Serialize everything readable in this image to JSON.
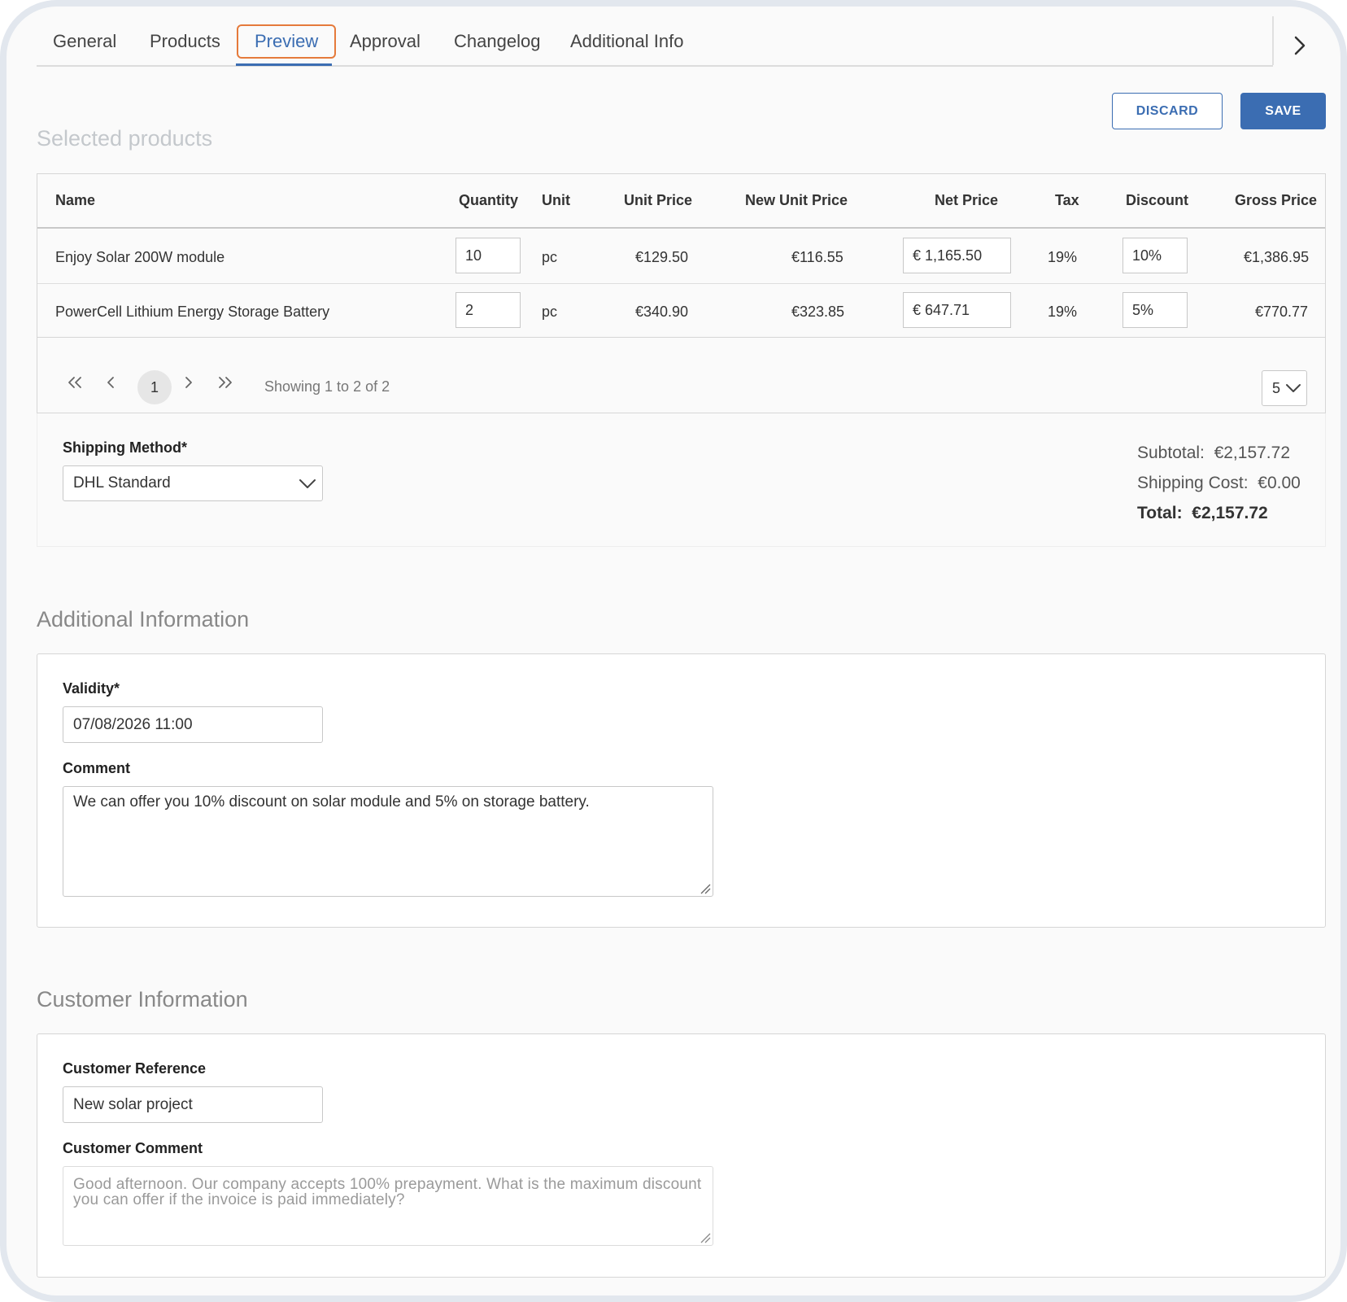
{
  "tabs": [
    {
      "label": "General"
    },
    {
      "label": "Products"
    },
    {
      "label": "Preview"
    },
    {
      "label": "Approval"
    },
    {
      "label": "Changelog"
    },
    {
      "label": "Additional Info"
    }
  ],
  "active_tab": "Preview",
  "actions": {
    "discard_label": "DISCARD",
    "save_label": "SAVE"
  },
  "selected_products": {
    "title": "Selected products",
    "columns": [
      "Name",
      "Quantity",
      "Unit",
      "Unit Price",
      "New Unit Price",
      "Net Price",
      "Tax",
      "Discount",
      "Gross Price"
    ],
    "rows": [
      {
        "name": "Enjoy Solar 200W module",
        "quantity": "10",
        "unit": "pc",
        "unit_price": "€129.50",
        "new_unit_price": "€116.55",
        "net_price": "€ 1,165.50",
        "tax": "19%",
        "discount": "10%",
        "gross_price": "€1,386.95"
      },
      {
        "name": "PowerCell Lithium Energy Storage Battery",
        "quantity": "2",
        "unit": "pc",
        "unit_price": "€340.90",
        "new_unit_price": "€323.85",
        "net_price": "€ 647.71",
        "tax": "19%",
        "discount": "5%",
        "gross_price": "€770.77"
      }
    ],
    "pagination": {
      "current_page": "1",
      "info": "Showing 1 to 2 of 2",
      "page_size": "5"
    }
  },
  "shipping": {
    "label": "Shipping Method*",
    "value": "DHL Standard"
  },
  "totals": {
    "subtotal_label": "Subtotal:",
    "subtotal": "€2,157.72",
    "shipping_label": "Shipping Cost:",
    "shipping": "€0.00",
    "total_label": "Total:",
    "total": "€2,157.72"
  },
  "additional_info": {
    "title": "Additional Information",
    "validity_label": "Validity*",
    "validity_value": "07/08/2026 11:00",
    "comment_label": "Comment",
    "comment_value": "We can offer you 10% discount on solar module and 5% on storage battery."
  },
  "customer_info": {
    "title": "Customer Information",
    "reference_label": "Customer Reference",
    "reference_value": "New solar project",
    "comment_label": "Customer Comment",
    "comment_value": "Good afternoon. Our company accepts 100% prepayment. What is the maximum discount you can offer if the invoice is paid immediately?"
  },
  "colors": {
    "accent": "#3b6db2",
    "active_tab_border": "#e57a3b"
  }
}
